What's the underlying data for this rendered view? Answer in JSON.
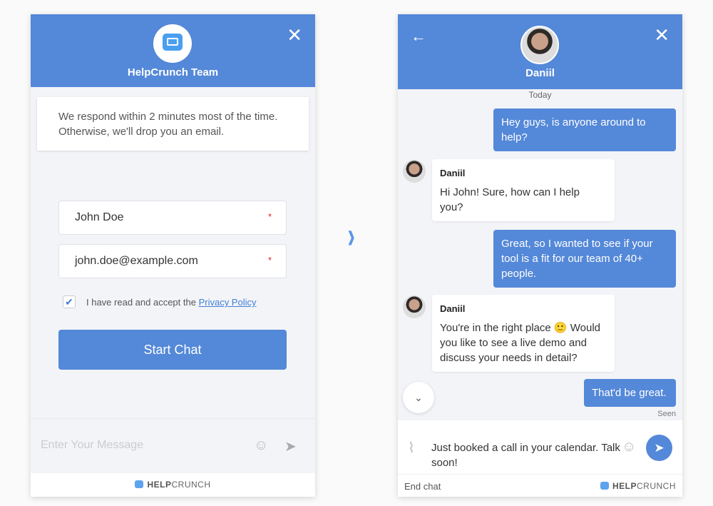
{
  "left": {
    "team_name": "HelpCrunch Team",
    "notice": [
      "We respond within 2 minutes most of the time.",
      "Otherwise, we'll drop you an email."
    ],
    "name_value": "John Doe",
    "email_value": "john.doe@example.com",
    "required_mark": "*",
    "consent_text": "I have read and accept the",
    "consent_link": "Privacy Policy",
    "consent_checked": true,
    "start_button": "Start Chat",
    "message_placeholder": "Enter Your Message",
    "brand_bold": "HELP",
    "brand_rest": "CRUNCH"
  },
  "right": {
    "agent_name": "Daniil",
    "date_label": "Today",
    "messages": [
      {
        "from": "user",
        "text": "Hey guys, is anyone around to help?"
      },
      {
        "from": "agent",
        "name": "Daniil",
        "text": "Hi John! Sure, how can I help you?"
      },
      {
        "from": "user",
        "text": "Great, so I wanted to see if your tool is a fit for our team of 40+ people."
      },
      {
        "from": "agent",
        "name": "Daniil",
        "text": "You're in the right place 🙂 Would you like to see a live demo and discuss your needs in detail?"
      },
      {
        "from": "user",
        "text": "That'd be great."
      }
    ],
    "seen_label": "Seen",
    "composer_value": "Just booked a call in your calendar. Talk soon!",
    "end_chat": "End chat",
    "brand_bold": "HELP",
    "brand_rest": "CRUNCH"
  },
  "colors": {
    "accent": "#5488d8",
    "required": "#e0262b"
  }
}
